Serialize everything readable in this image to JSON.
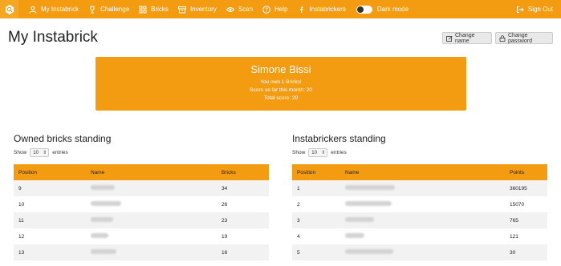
{
  "nav": {
    "items": [
      {
        "label": "My Instabrick",
        "icon": "user-icon"
      },
      {
        "label": "Challenge",
        "icon": "trophy-icon"
      },
      {
        "label": "Bricks",
        "icon": "grid-icon"
      },
      {
        "label": "Inventory",
        "icon": "archive-icon"
      },
      {
        "label": "Scan",
        "icon": "eye-icon"
      },
      {
        "label": "Help",
        "icon": "question-icon"
      },
      {
        "label": "Instabrickers",
        "icon": "facebook-icon"
      }
    ],
    "dark_mode_label": "Dark mode",
    "sign_out_label": "Sign Out"
  },
  "page": {
    "title": "My Instabrick",
    "change_name_label": "Change name",
    "change_password_label": "Change password"
  },
  "user_card": {
    "name": "Simone Bissi",
    "line1": "You own 1 Bricks!",
    "line2": "Score so far this month: 20",
    "line3": "Total score: 20"
  },
  "owned": {
    "title": "Owned bricks standing",
    "show": "Show",
    "entries_value": "10",
    "entries": "entries",
    "columns": [
      "Position",
      "Name",
      "Bricks"
    ],
    "rows": [
      {
        "position": "9",
        "bricks": "34"
      },
      {
        "position": "10",
        "bricks": "26"
      },
      {
        "position": "11",
        "bricks": "23"
      },
      {
        "position": "12",
        "bricks": "19"
      },
      {
        "position": "13",
        "bricks": "16"
      }
    ]
  },
  "instabrickers": {
    "title": "Instabrickers standing",
    "show": "Show",
    "entries_value": "10",
    "entries": "entries",
    "columns": [
      "Position",
      "Name",
      "Points"
    ],
    "rows": [
      {
        "position": "1",
        "points": "360195"
      },
      {
        "position": "2",
        "points": "15070"
      },
      {
        "position": "3",
        "points": "765"
      },
      {
        "position": "4",
        "points": "121"
      },
      {
        "position": "5",
        "points": "30"
      }
    ]
  },
  "colors": {
    "accent": "#f39c12",
    "row_stripe": "#f2f2f2"
  }
}
